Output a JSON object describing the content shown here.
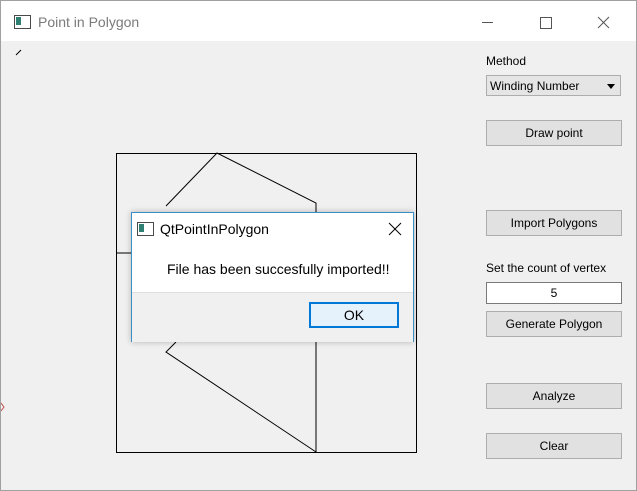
{
  "window": {
    "title": "Point in Polygon",
    "icon": "app-window-icon"
  },
  "controls": {
    "method_label": "Method",
    "method_value": "Winding Number",
    "draw_point": "Draw point",
    "import_polygons": "Import Polygons",
    "vertex_label": "Set the count of vertex",
    "vertex_value": "5",
    "generate_polygon": "Generate Polygon",
    "analyze": "Analyze",
    "clear": "Clear"
  },
  "dialog": {
    "title": "QtPointInPolygon",
    "message": "File has been succesfully imported!!",
    "ok_label": "OK"
  },
  "colors": {
    "window_bg": "#f0f0f0",
    "dialog_border": "#3c8ec7",
    "ok_border": "#0078d7"
  }
}
